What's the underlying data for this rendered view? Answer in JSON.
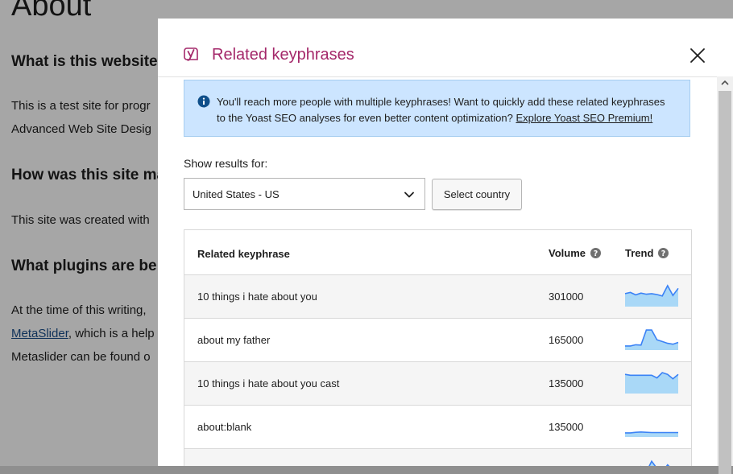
{
  "background": {
    "title": "About",
    "headings": [
      "What is this website",
      "How was this site ma",
      "What plugins are be"
    ],
    "paragraphs": [
      "This is a test site for progr",
      "Advanced Web Site Desig",
      "This site was created with",
      "At the time of this writing,",
      "Metaslider can be found o"
    ],
    "link_text": "MetaSlider",
    "link_suffix": ", which is a help"
  },
  "modal": {
    "title": "Related keyphrases",
    "alert": {
      "line1": "You'll reach more people with multiple keyphrases! Want to quickly add these related keyphrases",
      "line2_prefix": "to the Yoast SEO analyses for even better content optimization? ",
      "link": "Explore Yoast SEO Premium!"
    },
    "show_results_label": "Show results for:",
    "country_select": {
      "value": "United States - US"
    },
    "select_country_button": "Select country",
    "table": {
      "headers": {
        "keyphrase": "Related keyphrase",
        "volume": "Volume",
        "trend": "Trend"
      },
      "rows": [
        {
          "keyphrase": "10 things i hate about you",
          "volume": "301000",
          "trend": [
            0.55,
            0.62,
            0.48,
            0.58,
            0.52,
            0.55,
            0.5,
            0.42,
            1.0,
            0.45,
            0.85
          ]
        },
        {
          "keyphrase": "about my father",
          "volume": "165000",
          "trend": [
            0.05,
            0.05,
            0.12,
            0.1,
            0.95,
            0.95,
            0.4,
            0.3,
            0.2,
            0.15,
            0.25
          ]
        },
        {
          "keyphrase": "10 things i hate about you cast",
          "volume": "135000",
          "trend": [
            0.9,
            0.85,
            0.85,
            0.85,
            0.85,
            0.85,
            0.7,
            1.0,
            0.9,
            0.65,
            0.9
          ]
        },
        {
          "keyphrase": "about:blank",
          "volume": "135000",
          "trend": [
            0.05,
            0.05,
            0.08,
            0.1,
            0.08,
            0.07,
            0.07,
            0.07,
            0.07,
            0.07,
            0.07
          ]
        },
        {
          "keyphrase": "",
          "volume": "",
          "trend": [
            0.2,
            0.4,
            0.3,
            0.6,
            0.3,
            0.9,
            0.5,
            0.3,
            0.7,
            0.4,
            0.6
          ]
        }
      ]
    }
  },
  "colors": {
    "brand": "#a4286a",
    "alert_bg": "#cce5ff",
    "alert_icon": "#0f4f8a",
    "trend_line": "#3b82f6",
    "trend_fill": "#a9d8f7"
  },
  "icons": {
    "logo": "yoast-logo-icon",
    "close": "close-icon",
    "info": "info-icon",
    "chevron": "chevron-down-icon",
    "help": "question-icon"
  }
}
